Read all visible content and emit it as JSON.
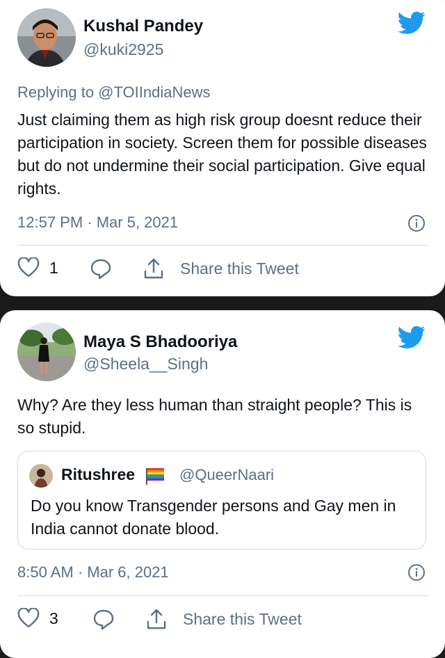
{
  "tweets": [
    {
      "name": "Kushal Pandey",
      "handle": "@kuki2925",
      "replying_to": "Replying to @TOIIndiaNews",
      "text": "Just claiming them as high risk group doesnt reduce their participation in society. Screen them for possible diseases but do not undermine their social participation. Give equal rights.",
      "timestamp": "12:57 PM · Mar 5, 2021",
      "like_count": "1",
      "share_label": "Share this Tweet"
    },
    {
      "name": "Maya S Bhadooriya",
      "handle": "@Sheela__Singh",
      "text": "Why? Are they less human than straight people? This is so stupid.",
      "quoted": {
        "name": "Ritushree",
        "handle": "@QueerNaari",
        "text": "Do you know Transgender persons and Gay men in India cannot donate blood."
      },
      "timestamp": "8:50 AM · Mar 6, 2021",
      "like_count": "3",
      "share_label": "Share this Tweet"
    }
  ],
  "colors": {
    "twitter_blue": "#1d9bf0",
    "secondary_text": "#5b7083",
    "primary_text": "#0f1419",
    "divider": "#cfd9de",
    "background": "#1a1a1a"
  },
  "icons": [
    "twitter-bird-icon",
    "info-icon",
    "heart-icon",
    "reply-bubble-icon",
    "share-icon",
    "rainbow-emoji-icon"
  ]
}
